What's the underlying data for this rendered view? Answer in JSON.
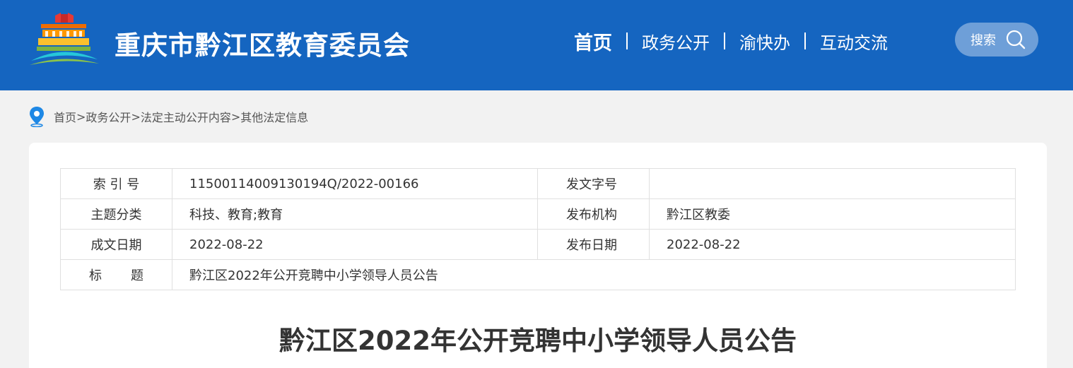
{
  "header": {
    "site_title": "重庆市黔江区教育委员会",
    "logo_icon": "building-logo-icon",
    "nav": [
      {
        "label": "首页"
      },
      {
        "label": "政务公开"
      },
      {
        "label": "渝快办"
      },
      {
        "label": "互动交流"
      }
    ],
    "search_label": "搜索"
  },
  "breadcrumb": {
    "icon": "location-pin-icon",
    "items": [
      "首页",
      "政务公开",
      "法定主动公开内容",
      "其他法定信息"
    ],
    "separator": ">"
  },
  "info": {
    "index_no_label": "索 引 号",
    "index_no_value": "11500114009130194Q/2022-00166",
    "doc_no_label": "发文字号",
    "doc_no_value": "",
    "topic_label": "主题分类",
    "topic_value": "科技、教育;教育",
    "publisher_label": "发布机构",
    "publisher_value": "黔江区教委",
    "written_date_label": "成文日期",
    "written_date_value": "2022-08-22",
    "publish_date_label": "发布日期",
    "publish_date_value": "2022-08-22",
    "title_label_a": "标",
    "title_label_b": "题",
    "title_value": "黔江区2022年公开竞聘中小学领导人员公告"
  },
  "article": {
    "title": "黔江区2022年公开竞聘中小学领导人员公告"
  },
  "colors": {
    "header_bg": "#1565c0",
    "page_bg": "#f2f2f2",
    "pin": "#1e88e5"
  }
}
